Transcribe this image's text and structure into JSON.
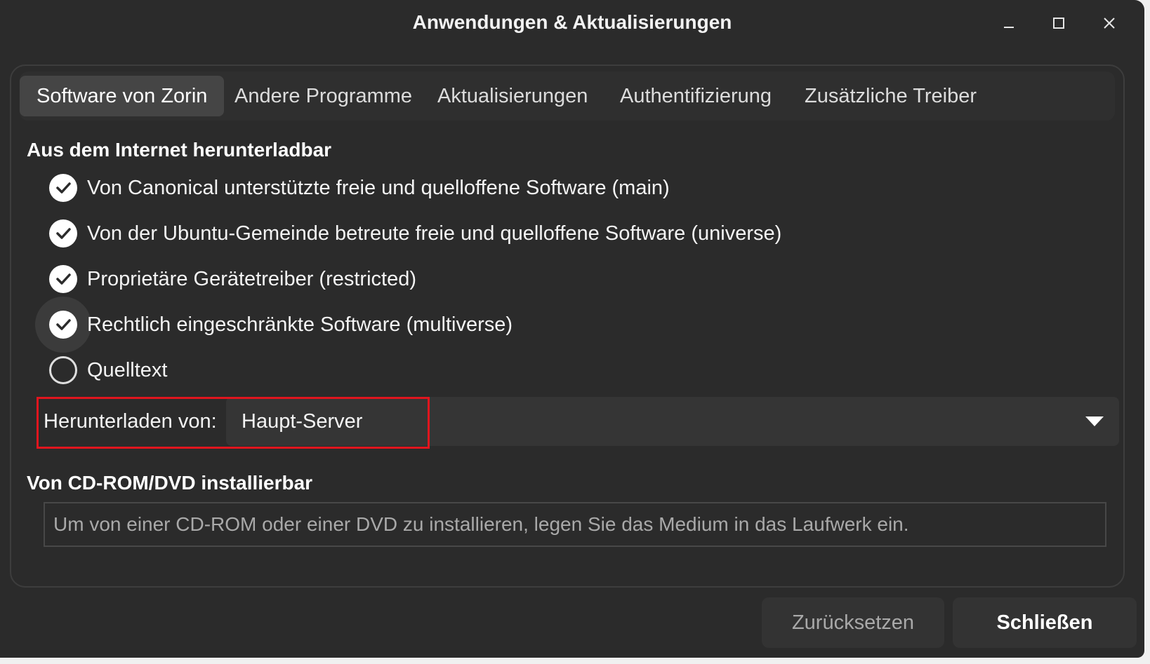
{
  "window": {
    "title": "Anwendungen & Aktualisierungen"
  },
  "tabs": [
    {
      "label": "Software von Zorin",
      "active": true
    },
    {
      "label": "Andere Programme",
      "active": false
    },
    {
      "label": "Aktualisierungen",
      "active": false
    },
    {
      "label": "Authentifizierung",
      "active": false
    },
    {
      "label": "Zusätzliche Treiber",
      "active": false
    }
  ],
  "internet": {
    "title": "Aus dem Internet herunterladbar",
    "sources": [
      {
        "label": "Von Canonical unterstützte freie und quelloffene Software (main)",
        "checked": true
      },
      {
        "label": "Von der Ubuntu-Gemeinde betreute freie und quelloffene Software (universe)",
        "checked": true
      },
      {
        "label": "Proprietäre Gerätetreiber (restricted)",
        "checked": true
      },
      {
        "label": "Rechtlich eingeschränkte Software (multiverse)",
        "checked": true
      },
      {
        "label": "Quelltext",
        "checked": false
      }
    ],
    "download_from": {
      "label": "Herunterladen von:",
      "value": "Haupt-Server"
    }
  },
  "cdrom": {
    "title": "Von CD-ROM/DVD installierbar",
    "message": "Um von einer CD-ROM oder einer DVD zu installieren, legen Sie das Medium in das Laufwerk ein."
  },
  "buttons": {
    "reset": "Zurücksetzen",
    "close": "Schließen"
  },
  "colors": {
    "background": "#2b2b2b",
    "highlight_border": "#e0151e"
  }
}
